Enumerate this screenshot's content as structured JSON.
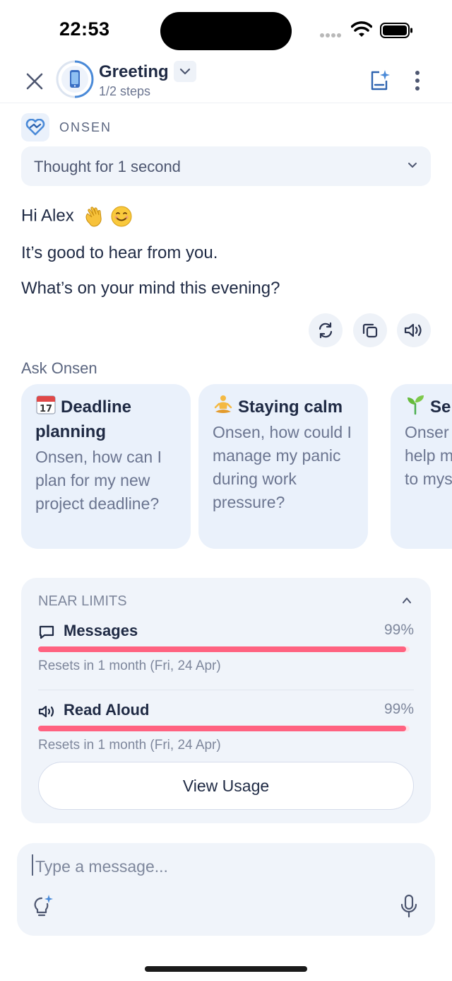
{
  "status_bar": {
    "time": "22:53"
  },
  "header": {
    "title": "Greeting",
    "steps": "1/2 steps"
  },
  "sender": {
    "name": "ONSEN"
  },
  "thought": {
    "label": "Thought for 1 second"
  },
  "messages": [
    "Hi Alex",
    "It’s good to hear from you.",
    "What’s on your mind this evening?"
  ],
  "ask": {
    "label": "Ask Onsen",
    "cards": [
      {
        "icon": "calendar-icon",
        "title": "Deadline planning",
        "body": "Onsen, how can I plan for my new project deadline?"
      },
      {
        "icon": "meditation-icon",
        "title": "Staying calm",
        "body": "Onsen, how could I manage my panic during work pressure?"
      },
      {
        "icon": "seedling-icon",
        "title": "Se compa",
        "body": "Onser help m to mys"
      }
    ]
  },
  "limits": {
    "heading": "NEAR LIMITS",
    "items": [
      {
        "name": "Messages",
        "percent_label": "99%",
        "percent": 99,
        "reset": "Resets in 1 month (Fri, 24 Apr)"
      },
      {
        "name": "Read Aloud",
        "percent_label": "99%",
        "percent": 99,
        "reset": "Resets in 1 month (Fri, 24 Apr)"
      }
    ],
    "button": "View Usage"
  },
  "composer": {
    "placeholder": "Type a message..."
  },
  "colors": {
    "accent": "#4a8ad8",
    "limit_bar": "#ff6280",
    "card_bg": "#eaf1fb"
  }
}
